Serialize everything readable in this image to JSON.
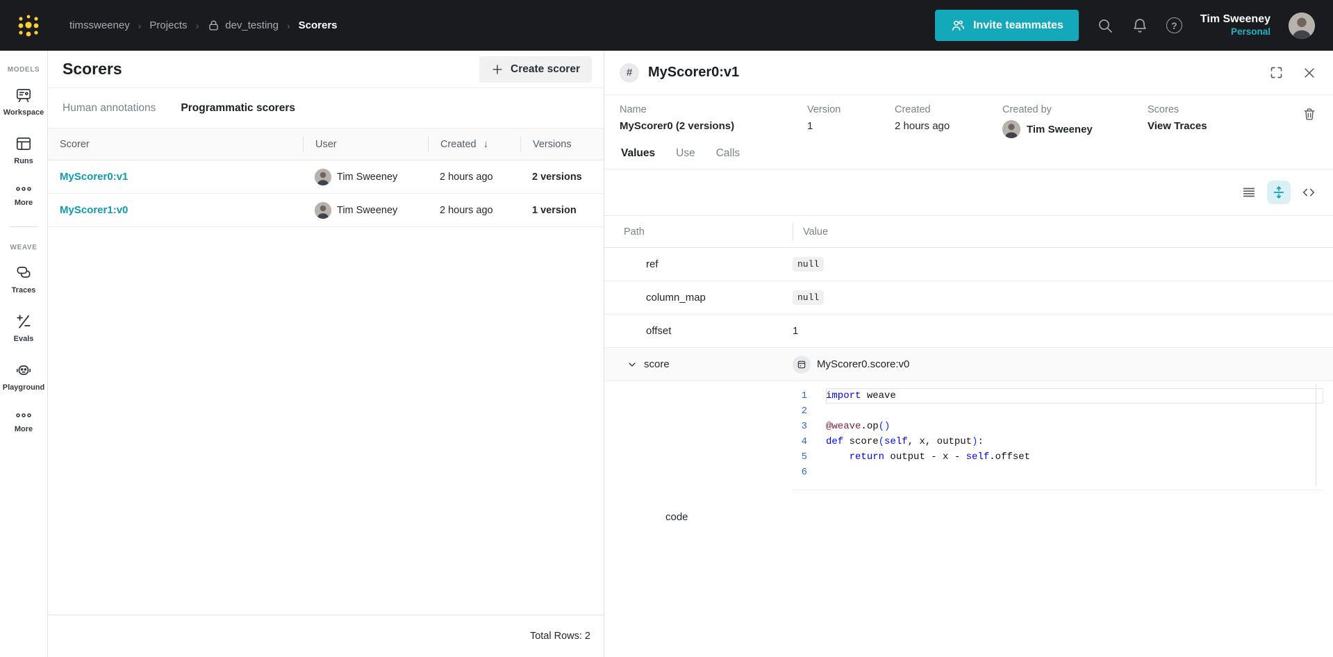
{
  "colors": {
    "accent_teal": "#13a9ba",
    "link_teal": "#0c9db2",
    "logo_yellow": "#ffcc33"
  },
  "icons": {
    "hash": "#",
    "help": "?",
    "sort_desc": "↓",
    "plus": "+"
  },
  "navbar": {
    "breadcrumb": {
      "account": "timssweeney",
      "section": "Projects",
      "project": "dev_testing",
      "page": "Scorers"
    },
    "invite_label": "Invite teammates",
    "user_name": "Tim Sweeney",
    "user_scope": "Personal"
  },
  "sidebar": {
    "models_label": "MODELS",
    "weave_label": "WEAVE",
    "models_items": [
      {
        "label": "Workspace"
      },
      {
        "label": "Runs"
      },
      {
        "label": "More"
      }
    ],
    "weave_items": [
      {
        "label": "Traces"
      },
      {
        "label": "Evals"
      },
      {
        "label": "Playground"
      },
      {
        "label": "More"
      }
    ]
  },
  "scorers": {
    "title": "Scorers",
    "create_label": "Create scorer",
    "tabs": [
      "Human annotations",
      "Programmatic scorers"
    ],
    "columns": [
      "Scorer",
      "User",
      "Created",
      "Versions"
    ],
    "rows": [
      {
        "name": "MyScorer0:v1",
        "user": "Tim Sweeney",
        "created": "2 hours ago",
        "versions": "2 versions"
      },
      {
        "name": "MyScorer1:v0",
        "user": "Tim Sweeney",
        "created": "2 hours ago",
        "versions": "1 version"
      }
    ],
    "total_label": "Total Rows: 2"
  },
  "detail": {
    "title": "MyScorer0:v1",
    "meta": [
      {
        "label": "Name",
        "value": "MyScorer0 (2 versions)"
      },
      {
        "label": "Version",
        "value": "1"
      },
      {
        "label": "Created",
        "value": "2 hours ago"
      },
      {
        "label": "Created by",
        "value": "Tim Sweeney"
      },
      {
        "label": "Scores",
        "value": "View Traces"
      }
    ],
    "tabs": [
      "Values",
      "Use",
      "Calls"
    ],
    "kv": {
      "columns": [
        "Path",
        "Value"
      ],
      "rows": [
        {
          "path": "ref",
          "value": "null",
          "type": "badge"
        },
        {
          "path": "column_map",
          "value": "null",
          "type": "badge"
        },
        {
          "path": "offset",
          "value": "1",
          "type": "plain"
        },
        {
          "path": "score",
          "value": "MyScorer0.score:v0",
          "type": "op"
        }
      ],
      "code_path": "code"
    },
    "code": {
      "lines": [
        {
          "n": "1",
          "tokens": [
            [
              "kw",
              "import"
            ],
            [
              "pl",
              " weave"
            ]
          ]
        },
        {
          "n": "2",
          "tokens": []
        },
        {
          "n": "3",
          "tokens": [
            [
              "dec",
              "@weave"
            ],
            [
              "pl",
              ".op"
            ],
            [
              "par",
              "()"
            ]
          ]
        },
        {
          "n": "4",
          "tokens": [
            [
              "kw",
              "def"
            ],
            [
              "pl",
              " score"
            ],
            [
              "par",
              "("
            ],
            [
              "kw",
              "self"
            ],
            [
              "pl",
              ", x, output"
            ],
            [
              "par",
              ")"
            ],
            [
              "pl",
              ":"
            ]
          ]
        },
        {
          "n": "5",
          "tokens": [
            [
              "pl",
              "    "
            ],
            [
              "kw",
              "return"
            ],
            [
              "pl",
              " output - x - "
            ],
            [
              "kw",
              "self"
            ],
            [
              "pl",
              ".offset"
            ]
          ]
        },
        {
          "n": "6",
          "tokens": []
        }
      ]
    }
  }
}
